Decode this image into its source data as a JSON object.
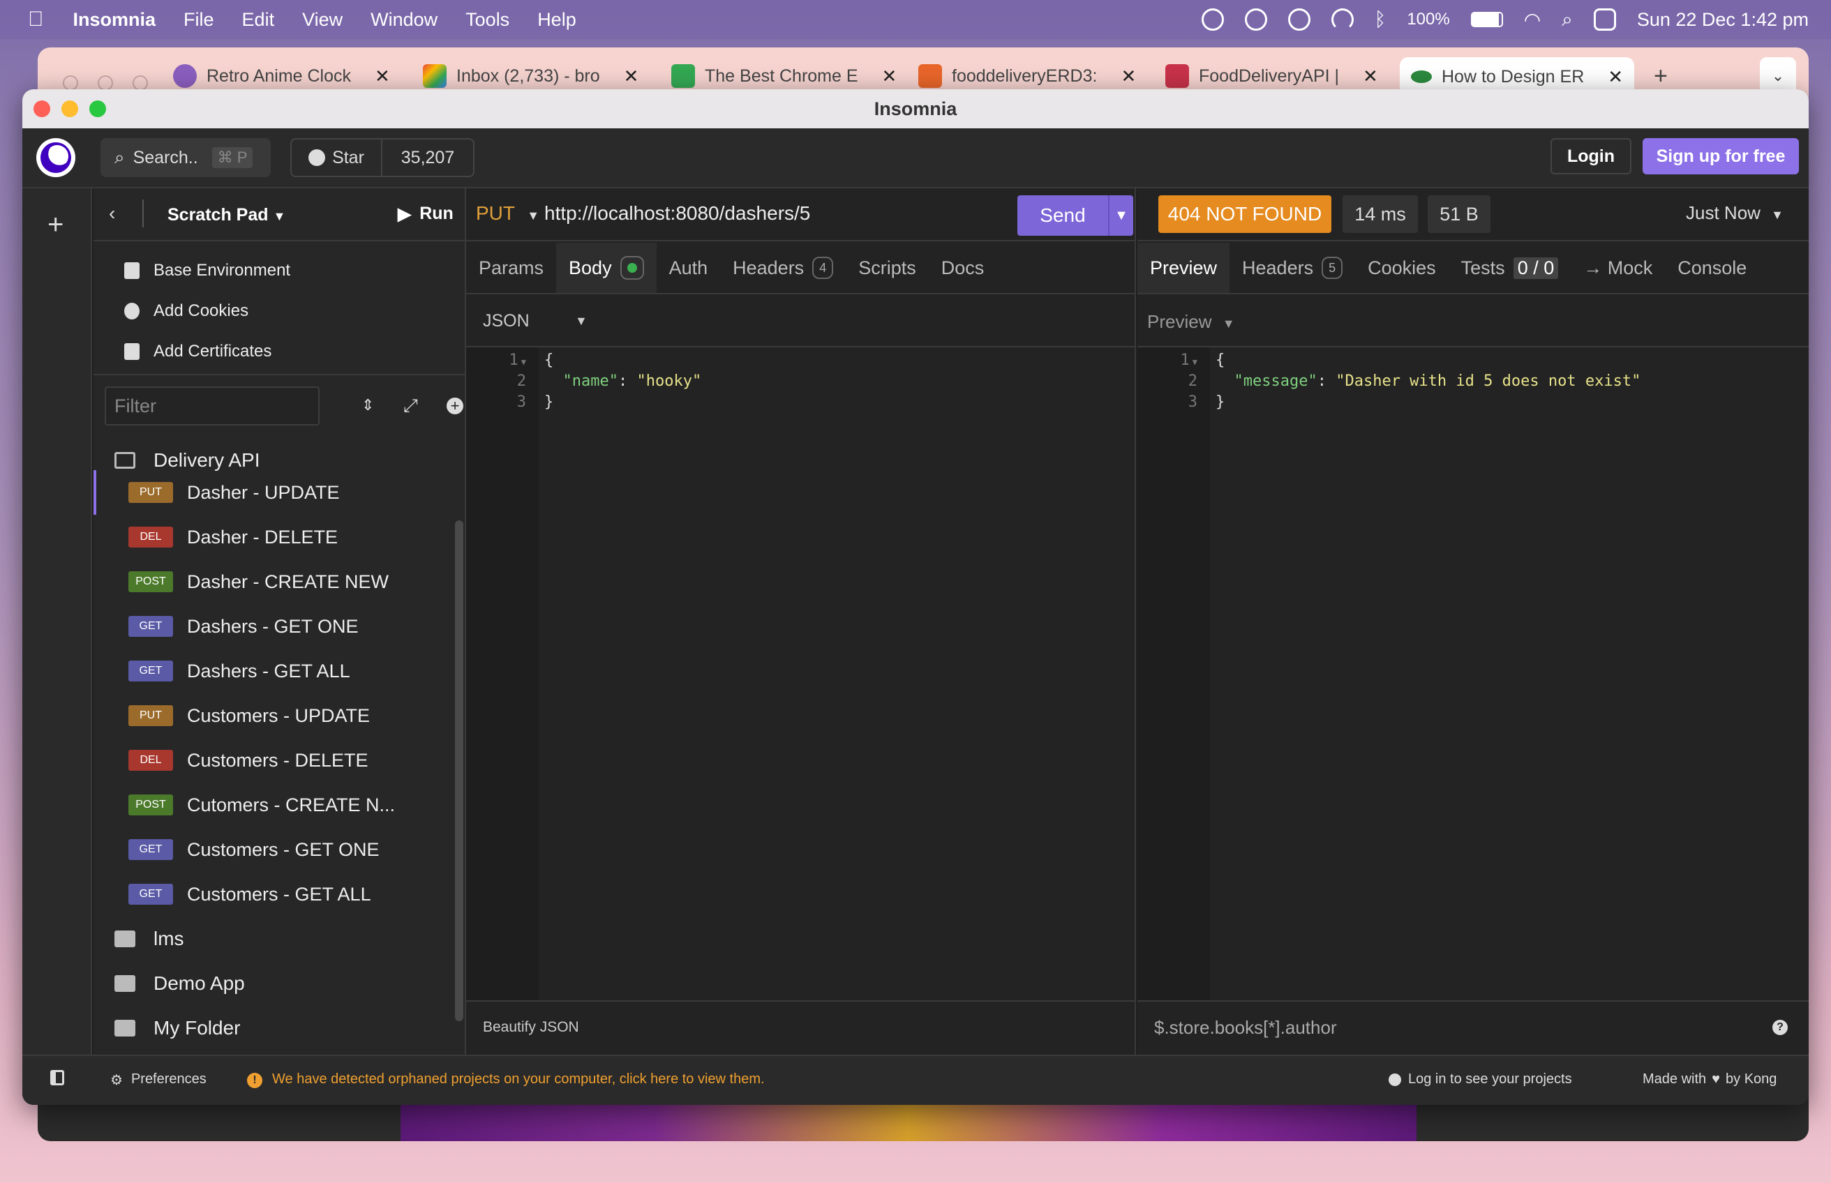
{
  "menubar": {
    "app_name": "Insomnia",
    "items": [
      "File",
      "Edit",
      "View",
      "Window",
      "Tools",
      "Help"
    ],
    "battery": "100%",
    "datetime": "Sun 22 Dec  1:42 pm"
  },
  "browser_tabs": [
    {
      "title": "Retro Anime Clock",
      "icon": "clock-favicon"
    },
    {
      "title": "Inbox (2,733) - bro",
      "icon": "gmail-favicon"
    },
    {
      "title": "The Best Chrome E",
      "icon": "sheets-favicon"
    },
    {
      "title": "fooddeliveryERD3:",
      "icon": "drawsql-favicon"
    },
    {
      "title": "FoodDeliveryAPI |",
      "icon": "trello-favicon"
    },
    {
      "title": "How to Design ER",
      "icon": "link-favicon"
    }
  ],
  "window": {
    "title": "Insomnia"
  },
  "topbar": {
    "search_label": "Search..",
    "search_shortcut": "⌘ P",
    "star_label": "Star",
    "star_count": "35,207",
    "login_label": "Login",
    "signup_label": "Sign up for free"
  },
  "sidebar": {
    "project": "Scratch Pad",
    "run_label": "Run",
    "links": [
      "Base Environment",
      "Add Cookies",
      "Add Certificates"
    ],
    "filter_placeholder": "Filter",
    "folder_open": "Delivery API",
    "requests": [
      {
        "method": "PUT",
        "name": "Dasher - UPDATE"
      },
      {
        "method": "DEL",
        "name": "Dasher - DELETE"
      },
      {
        "method": "POST",
        "name": "Dasher - CREATE NEW"
      },
      {
        "method": "GET",
        "name": "Dashers - GET ONE"
      },
      {
        "method": "GET",
        "name": "Dashers - GET ALL"
      },
      {
        "method": "PUT",
        "name": "Customers - UPDATE"
      },
      {
        "method": "DEL",
        "name": "Customers - DELETE"
      },
      {
        "method": "POST",
        "name": "Cutomers - CREATE N..."
      },
      {
        "method": "GET",
        "name": "Customers - GET ONE"
      },
      {
        "method": "GET",
        "name": "Customers - GET ALL"
      }
    ],
    "folders": [
      "lms",
      "Demo App",
      "My Folder"
    ]
  },
  "request": {
    "method": "PUT",
    "url": "http://localhost:8080/dashers/5",
    "send_label": "Send",
    "tabs": [
      "Params",
      "Body",
      "Auth",
      "Headers",
      "Scripts",
      "Docs"
    ],
    "headers_count": "4",
    "body_type": "JSON",
    "line_numbers": [
      "1",
      "2",
      "3"
    ],
    "body_key": "\"name\"",
    "body_value": "\"hooky\"",
    "footer_label": "Beautify JSON"
  },
  "response": {
    "status": "404 NOT FOUND",
    "time": "14 ms",
    "size": "51 B",
    "when": "Just Now",
    "tabs": [
      "Preview",
      "Headers",
      "Cookies",
      "Tests",
      "→ Mock",
      "Console"
    ],
    "headers_count": "5",
    "tests_value": "0 / 0",
    "preview_mode": "Preview",
    "line_numbers": [
      "1",
      "2",
      "3"
    ],
    "body_key": "\"message\"",
    "body_value": "\"Dasher with id 5 does not exist\"",
    "filter_placeholder": "$.store.books[*].author"
  },
  "statusbar": {
    "preferences": "Preferences",
    "orphan_warning": "We have detected orphaned projects on your computer, click here to view them.",
    "login_prompt": "Log in to see your projects",
    "made_with": "Made with",
    "by": "by Kong"
  },
  "colors": {
    "accent": "#7d67d8",
    "status_404": "#e58b1f",
    "put": "#9b6b2c",
    "delete": "#a8382e",
    "post": "#4c7a2b",
    "get": "#5a5aa6"
  }
}
